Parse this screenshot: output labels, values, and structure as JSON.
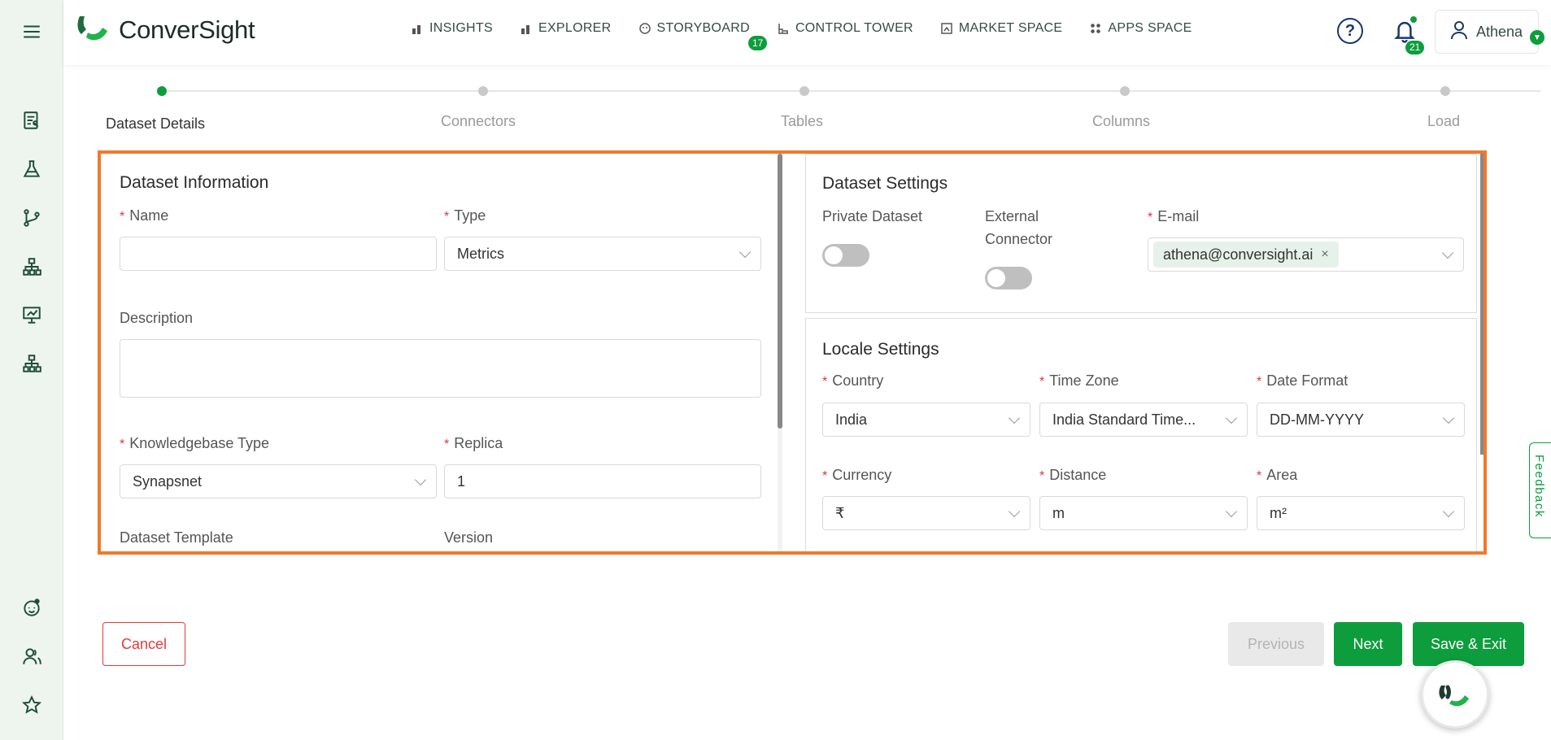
{
  "app": {
    "brand": "ConverSight"
  },
  "nav": {
    "items": [
      {
        "label": "INSIGHTS",
        "icon": "bar-chart-icon"
      },
      {
        "label": "EXPLORER",
        "icon": "bar-chart-icon"
      },
      {
        "label": "STORYBOARD",
        "icon": "palette-icon"
      },
      {
        "label": "CONTROL TOWER",
        "icon": "tower-icon"
      },
      {
        "label": "MARKET SPACE",
        "icon": "market-icon"
      },
      {
        "label": "APPS SPACE",
        "icon": "apps-grid-icon"
      }
    ],
    "storyboard_badge": "17"
  },
  "header": {
    "help_icon": "?",
    "notifications_count": "21",
    "user_name": "Athena"
  },
  "stepper": {
    "steps": [
      {
        "label": "Dataset Details",
        "active": true
      },
      {
        "label": "Connectors",
        "active": false
      },
      {
        "label": "Tables",
        "active": false
      },
      {
        "label": "Columns",
        "active": false
      },
      {
        "label": "Load",
        "active": false
      }
    ]
  },
  "dataset_info": {
    "title": "Dataset Information",
    "name_label": "Name",
    "name_value": "",
    "type_label": "Type",
    "type_value": "Metrics",
    "description_label": "Description",
    "kb_type_label": "Knowledgebase Type",
    "kb_type_value": "Synapsnet",
    "replica_label": "Replica",
    "replica_value": "1",
    "template_label": "Dataset Template",
    "version_label": "Version"
  },
  "dataset_settings": {
    "title": "Dataset Settings",
    "private_label": "Private Dataset",
    "private_on": false,
    "external_label_1": "External",
    "external_label_2": "Connector",
    "external_on": false,
    "email_label": "E-mail",
    "email_tag": "athena@conversight.ai",
    "remove_tag": "×"
  },
  "locale_settings": {
    "title": "Locale Settings",
    "country_label": "Country",
    "country_value": "India",
    "timezone_label": "Time Zone",
    "timezone_value": "India Standard Time...",
    "date_format_label": "Date Format",
    "date_format_value": "DD-MM-YYYY",
    "currency_label": "Currency",
    "currency_value": "₹",
    "distance_label": "Distance",
    "distance_value": "m",
    "area_label": "Area",
    "area_value": "m²"
  },
  "actions": {
    "cancel": "Cancel",
    "previous": "Previous",
    "next": "Next",
    "save_exit": "Save & Exit"
  },
  "feedback": "Feedback",
  "colors": {
    "brand_green": "#0e9d3d",
    "highlight": "#f0792b",
    "required": "#e0343a"
  },
  "sidebar_icons": [
    "menu-icon",
    "report-icon",
    "flask-icon",
    "branch-icon",
    "hierarchy-icon",
    "presentation-icon",
    "hierarchy-icon",
    "bot-icon",
    "users-icon",
    "star-icon"
  ]
}
